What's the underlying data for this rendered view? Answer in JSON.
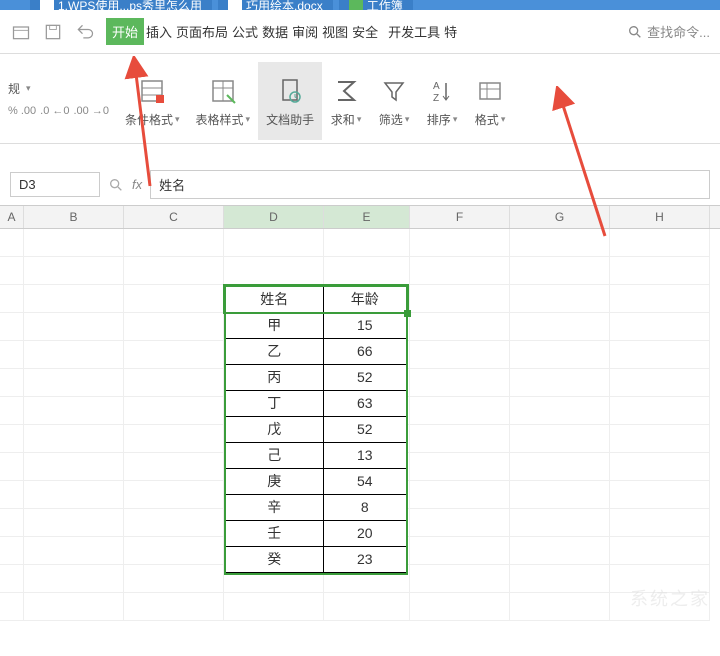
{
  "tabs": [
    {
      "label": "1.WPS使用...ps秀里怎么用"
    },
    {
      "label": "巧用绘本.docx"
    },
    {
      "label": "工作簿"
    }
  ],
  "menu": {
    "items": [
      "开始",
      "插入",
      "页面布局",
      "公式",
      "数据",
      "审阅",
      "视图",
      "安全",
      "开发工具",
      "特"
    ],
    "active_index": 0,
    "search_placeholder": "查找命令..."
  },
  "ribbon_left": {
    "row1_text": "规",
    "row2_parts": [
      ".%",
      ".00",
      "←0",
      ".00",
      "→0"
    ]
  },
  "ribbon_buttons": [
    {
      "key": "cond-fmt",
      "label": "条件格式",
      "dropdown": true
    },
    {
      "key": "table-style",
      "label": "表格样式",
      "dropdown": true
    },
    {
      "key": "doc-helper",
      "label": "文档助手",
      "dropdown": false,
      "highlight": true
    },
    {
      "key": "sum",
      "label": "求和",
      "dropdown": true
    },
    {
      "key": "filter",
      "label": "筛选",
      "dropdown": true
    },
    {
      "key": "sort",
      "label": "排序",
      "dropdown": true
    },
    {
      "key": "format",
      "label": "格式",
      "dropdown": true
    }
  ],
  "formula_bar": {
    "cell_ref": "D3",
    "fx_label": "fx",
    "value": "姓名"
  },
  "columns": [
    {
      "label": "A",
      "width": 24
    },
    {
      "label": "B",
      "width": 100
    },
    {
      "label": "C",
      "width": 100
    },
    {
      "label": "D",
      "width": 100,
      "selected": true
    },
    {
      "label": "E",
      "width": 86,
      "selected": true
    },
    {
      "label": "F",
      "width": 100
    },
    {
      "label": "G",
      "width": 100
    },
    {
      "label": "H",
      "width": 100
    }
  ],
  "chart_data": {
    "type": "table",
    "headers": [
      "姓名",
      "年龄"
    ],
    "rows": [
      [
        "甲",
        15
      ],
      [
        "乙",
        66
      ],
      [
        "丙",
        52
      ],
      [
        "丁",
        63
      ],
      [
        "戊",
        52
      ],
      [
        "己",
        13
      ],
      [
        "庚",
        54
      ],
      [
        "辛",
        8
      ],
      [
        "壬",
        20
      ],
      [
        "癸",
        23
      ]
    ],
    "position": {
      "col_start": "D",
      "row_start": 3
    }
  },
  "watermark": "系统之家"
}
